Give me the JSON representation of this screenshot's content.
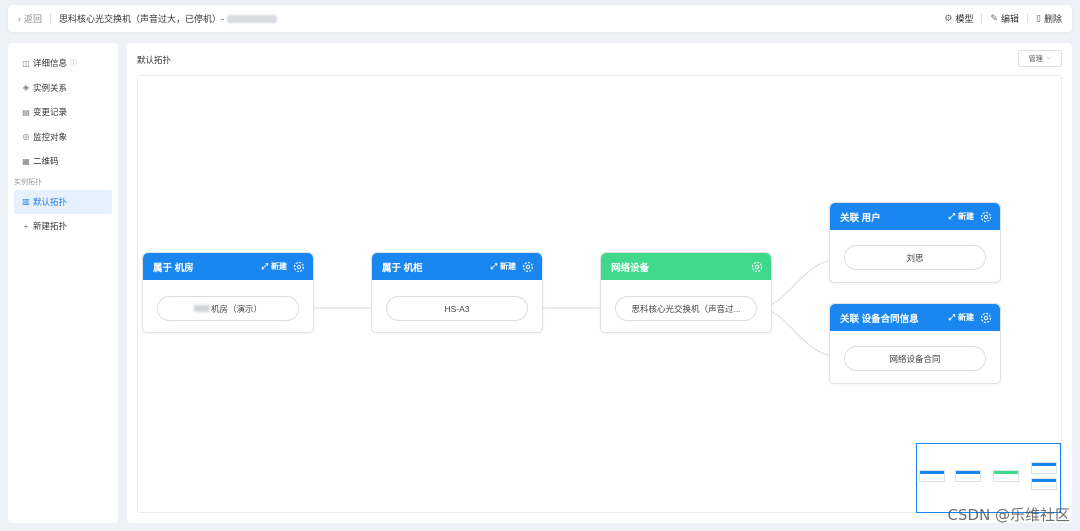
{
  "header": {
    "back_label": "返回",
    "title": "思科核心光交换机（声音过大，已停机）-",
    "actions": [
      {
        "label": "模型",
        "icon": "model-icon"
      },
      {
        "label": "编辑",
        "icon": "edit-icon"
      },
      {
        "label": "删除",
        "icon": "delete-icon"
      }
    ]
  },
  "sidebar": {
    "items": [
      {
        "label": "详细信息",
        "icon": "detail-icon"
      },
      {
        "label": "实例关系",
        "icon": "layers-icon"
      },
      {
        "label": "变更记录",
        "icon": "record-icon"
      },
      {
        "label": "监控对象",
        "icon": "monitor-icon"
      },
      {
        "label": "二维码",
        "icon": "qrcode-icon"
      }
    ],
    "group_label": "实例拓扑",
    "topology_items": [
      {
        "label": "默认拓扑",
        "icon": "chart-icon",
        "active": true
      },
      {
        "label": "新建拓扑",
        "icon": "plus-icon",
        "active": false
      }
    ]
  },
  "main": {
    "title": "默认拓扑",
    "manage_label": "管理"
  },
  "topology": {
    "nodes": {
      "room": {
        "header": "属于 机房",
        "new_label": "新建",
        "item": "机房（演示）",
        "color": "#1a86f0"
      },
      "cabinet": {
        "header": "属于 机柜",
        "new_label": "新建",
        "item": "HS-A3",
        "color": "#1a86f0"
      },
      "device": {
        "header": "网络设备",
        "item": "思科核心光交换机（声音过...",
        "color": "#3fd98c"
      },
      "user": {
        "header": "关联 用户",
        "new_label": "新建",
        "item": "刘思",
        "color": "#1a86f0"
      },
      "contract": {
        "header": "关联 设备合同信息",
        "new_label": "新建",
        "item": "网络设备合同",
        "color": "#1a86f0"
      }
    }
  },
  "watermark": "CSDN @乐维社区"
}
